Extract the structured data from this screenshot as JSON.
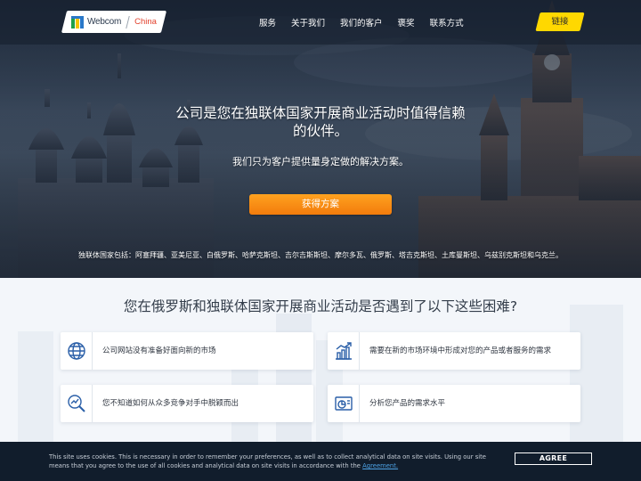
{
  "header": {
    "logo_text": "Webcom",
    "logo_region": "China",
    "nav": [
      "服务",
      "关于我们",
      "我们的客户",
      "褒奖",
      "联系方式"
    ],
    "cta_label": "链接"
  },
  "hero": {
    "title": "公司是您在独联体国家开展商业活动时值得信赖的伙伴。",
    "subtitle": "我们只为客户提供量身定做的解决方案。",
    "button_label": "获得方案",
    "countries": "独联体国家包括：阿塞拜疆、亚美尼亚、白俄罗斯、哈萨克斯坦、吉尔吉斯斯坦、摩尔多瓦、俄罗斯、塔吉克斯坦、土库曼斯坦、乌兹别克斯坦和乌克兰。"
  },
  "problems": {
    "title": "您在俄罗斯和独联体国家开展商业活动是否遇到了以下这些困难?",
    "items": [
      {
        "icon": "globe-icon",
        "text": "公司网站没有准备好面向新的市场"
      },
      {
        "icon": "growth-chart-icon",
        "text": "需要在新的市场环境中形成对您的产品或者服务的需求"
      },
      {
        "icon": "search-trend-icon",
        "text": "您不知道如何从众多竞争对手中脱颖而出"
      },
      {
        "icon": "analytics-icon",
        "text": "分析您产品的需求水平"
      }
    ]
  },
  "cookie": {
    "text": "This site uses cookies. This is necessary in order to remember your preferences, as well as to collect analytical data on site visits. Using our site means that you agree to the use of all cookies and analytical data on site visits in accordance with the",
    "link": "Agreement.",
    "agree_label": "AGREE"
  },
  "colors": {
    "accent_yellow": "#ffd800",
    "cta_orange": "#f58a12",
    "icon_blue": "#2a5fa8",
    "cookie_bg": "#111d2c"
  }
}
